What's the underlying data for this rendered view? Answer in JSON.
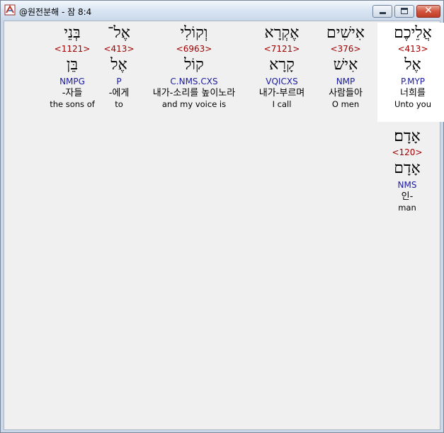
{
  "window": {
    "title": "@원전분해 - 잠 8:4"
  },
  "controls": {
    "minimize_icon": "minimize-icon",
    "maximize_icon": "maximize-icon",
    "close_icon": "close-icon",
    "close_glyph": "✕"
  },
  "colors": {
    "strong_number": "#a00000",
    "parsing": "#1a1aa0",
    "highlight_bg": "#ffffff"
  },
  "words": [
    {
      "hebrew": "אֲלֵיכֶם",
      "strong": "<413>",
      "lemma": "אֶל",
      "parsing": "P.MYP",
      "korean": "너희를",
      "english": "Unto you",
      "highlighted": true
    },
    {
      "hebrew": "אִישִׁים",
      "strong": "<376>",
      "lemma": "אִישׁ",
      "parsing": "NMP",
      "korean": "사람들아",
      "english": "O men",
      "highlighted": false
    },
    {
      "hebrew": "אֶקְרָא",
      "strong": "<7121>",
      "lemma": "קָרָא",
      "parsing": "VQICXS",
      "korean": "내가-부르며",
      "english": "I call",
      "highlighted": false
    },
    {
      "hebrew": "וְקוֹלִי",
      "strong": "<6963>",
      "lemma": "קוֹל",
      "parsing": "C.NMS.CXS",
      "korean": "내가-소리를 높이노라",
      "english": "and my voice is",
      "highlighted": false
    },
    {
      "hebrew": "אֶל־",
      "strong": "<413>",
      "lemma": "אֶל",
      "parsing": "P",
      "korean": "-에게",
      "english": "to",
      "highlighted": false
    },
    {
      "hebrew": "בְּנֵי",
      "strong": "<1121>",
      "lemma": "בֵּן",
      "parsing": "NMPG",
      "korean": "-자들",
      "english": "the sons of",
      "highlighted": false
    },
    {
      "hebrew": "אָדָם׃",
      "strong": "<120>",
      "lemma": "אָדָם",
      "parsing": "NMS",
      "korean": "인-",
      "english": "man",
      "highlighted": false
    }
  ]
}
